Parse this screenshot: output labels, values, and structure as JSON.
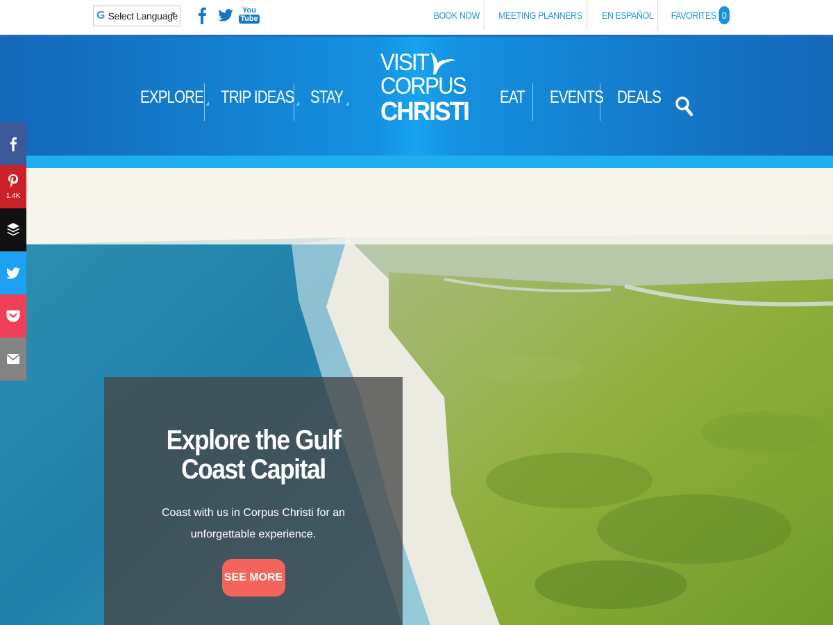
{
  "utility": {
    "language_label": "Select Language",
    "language_arrow": "▼",
    "google_letter": "G",
    "youtube_you": "You",
    "youtube_tube": "Tube",
    "links": {
      "book_now": "BOOK NOW",
      "meeting_planners": "MEETING PLANNERS",
      "en_espanol": "EN ESPAÑOL",
      "favorites": "FAVORITES"
    },
    "favorites_count": "0"
  },
  "nav": {
    "explore": "EXPLORE",
    "trip_ideas": "TRIP IDEAS",
    "stay": "STAY",
    "eat": "EAT",
    "events": "EVENTS",
    "deals": "DEALS"
  },
  "logo": {
    "line1": "VISIT",
    "line2": "CORPUS",
    "line3": "CHRISTI"
  },
  "hero": {
    "title": "Explore the Gulf Coast Capital",
    "text": "Coast with us in Corpus Christi for an unforgettable experience.",
    "button": "SEE MORE"
  },
  "share": {
    "pinterest_count": "1.4K"
  },
  "colors": {
    "accent": "#1a93d8",
    "header_blue": "#1366b8",
    "stripe": "#20aef0",
    "button": "#f4645a",
    "facebook": "#3b5998",
    "pinterest": "#cb2027",
    "buffer": "#111111",
    "twitter": "#1da1f2",
    "pocket": "#ee4056",
    "email": "#848484"
  }
}
